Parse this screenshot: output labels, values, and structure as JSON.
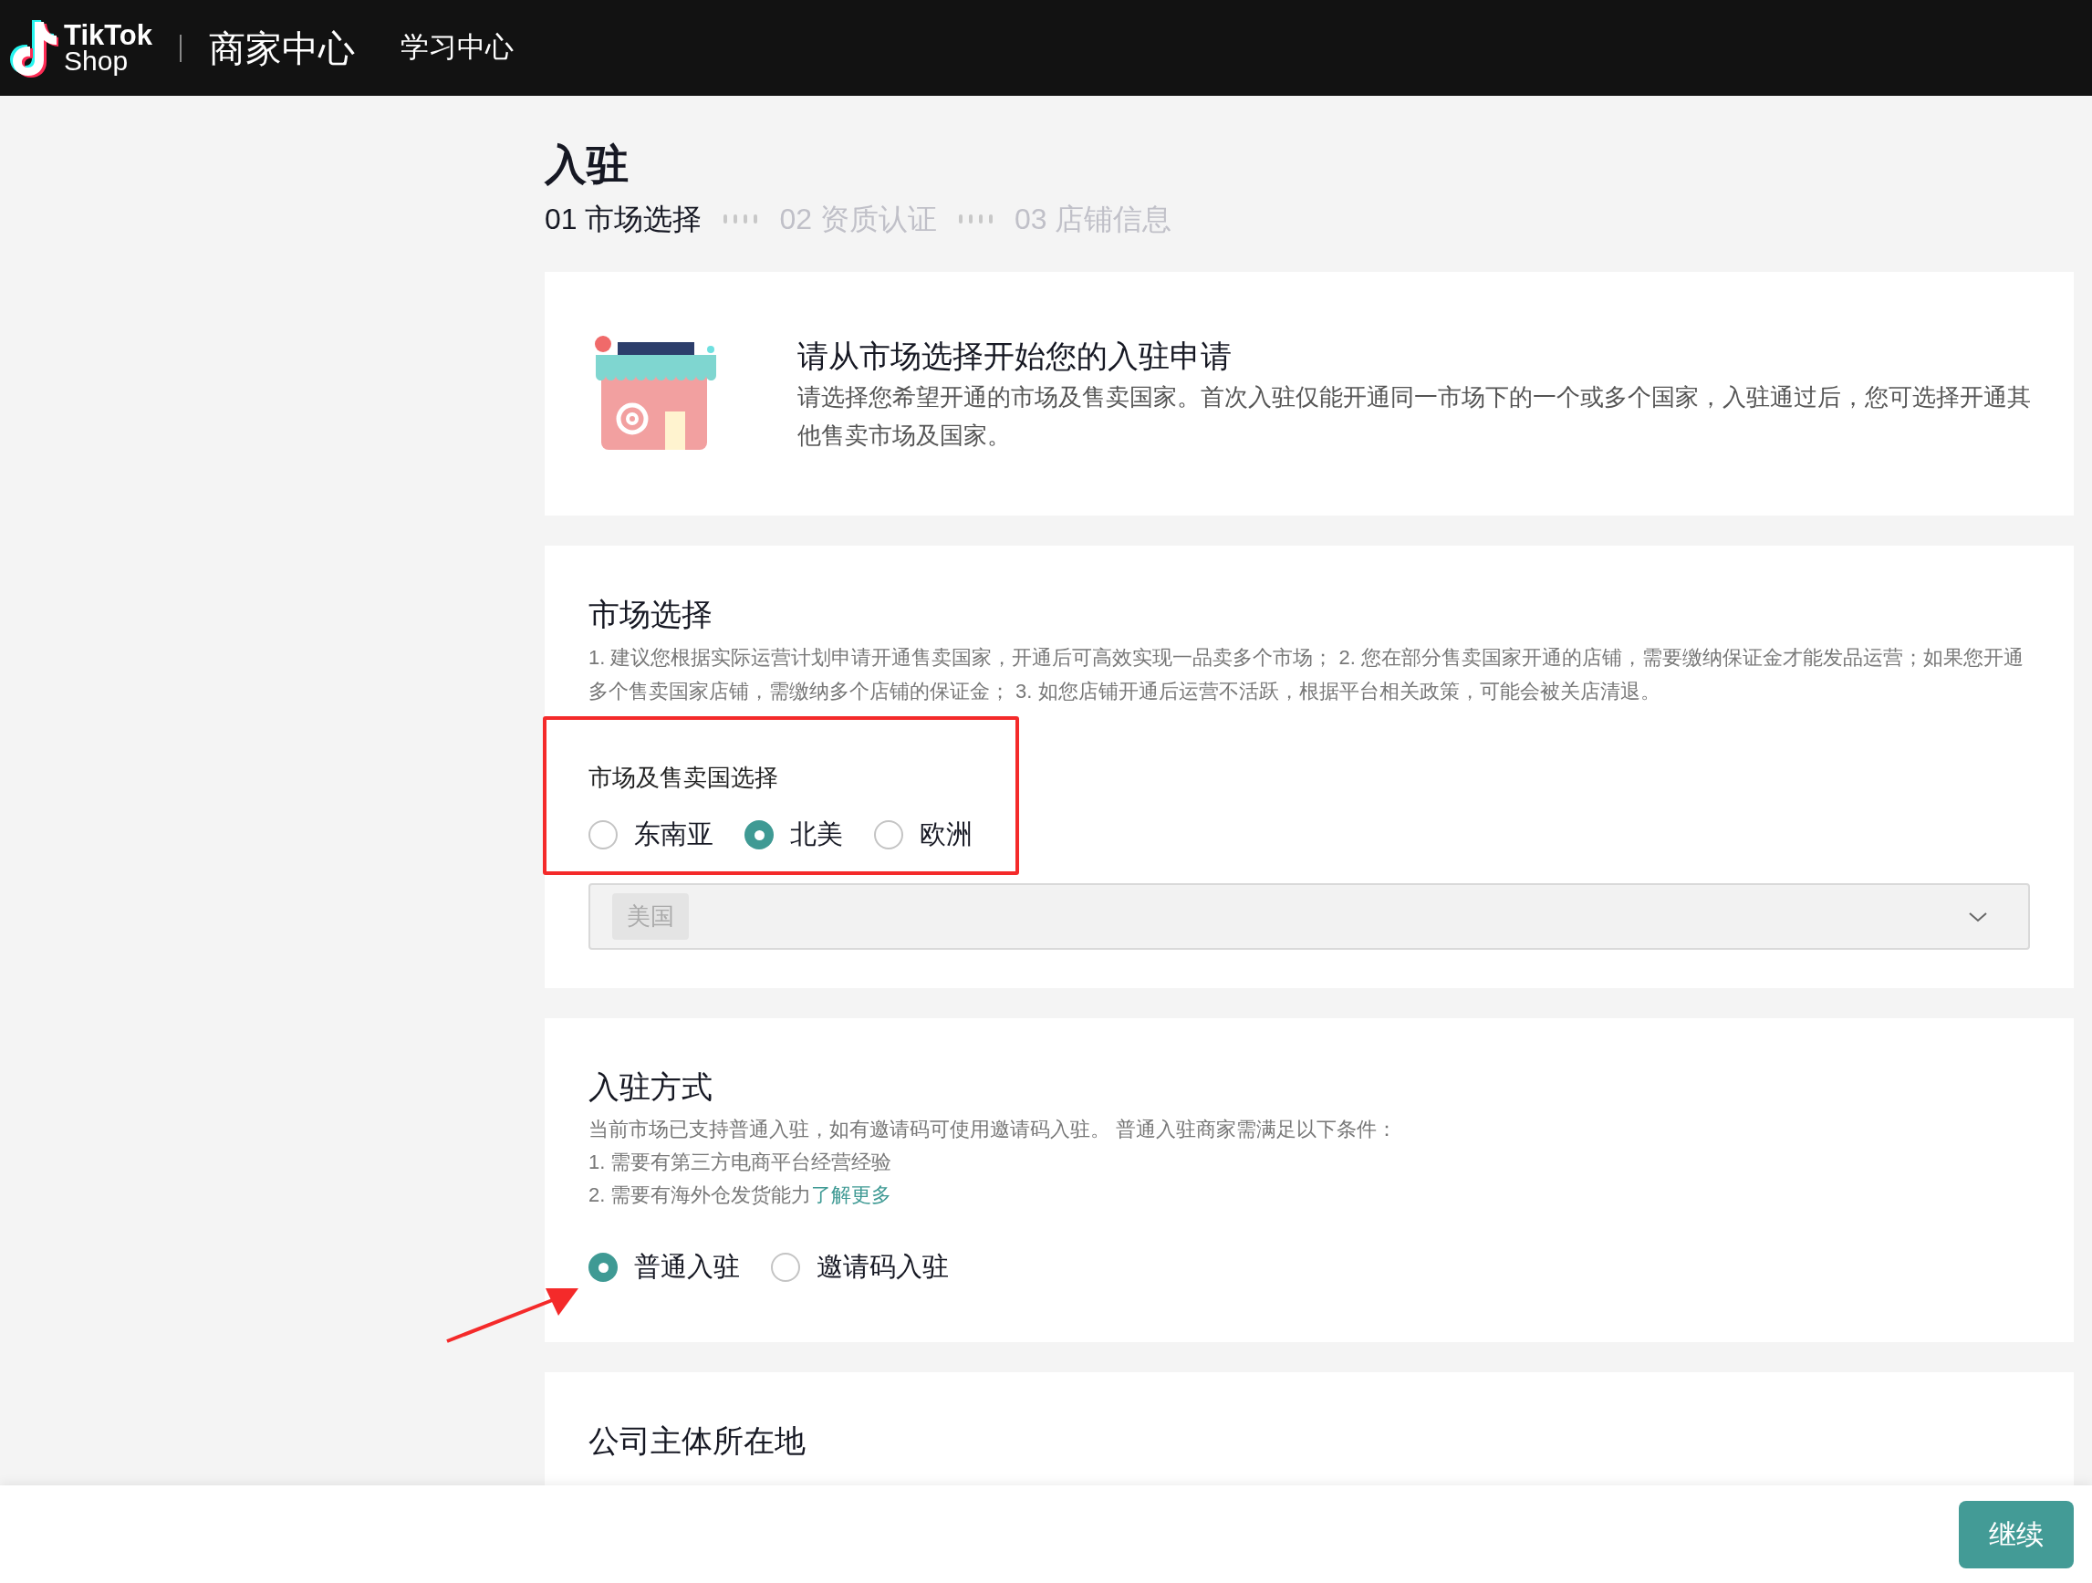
{
  "header": {
    "brand": [
      "TikTok",
      "Shop"
    ],
    "nav": [
      {
        "label": "商家中心",
        "selected": true
      },
      {
        "label": "学习中心",
        "selected": false
      }
    ]
  },
  "page_title": "入驻",
  "steps": [
    {
      "label": "01 市场选择",
      "active": true
    },
    {
      "label": "02 资质认证",
      "active": false
    },
    {
      "label": "03 店铺信息",
      "active": false
    }
  ],
  "intro": {
    "title": "请从市场选择开始您的入驻申请",
    "text": "请选择您希望开通的市场及售卖国家。首次入驻仅能开通同一市场下的一个或多个国家，入驻通过后，您可选择开通其他售卖市场及国家。"
  },
  "market": {
    "title": "市场选择",
    "note": "1. 建议您根据实际运营计划申请开通售卖国家，开通后可高效实现一品卖多个市场； 2. 您在部分售卖国家开通的店铺，需要缴纳保证金才能发品运营；如果您开通多个售卖国家店铺，需缴纳多个店铺的保证金； 3. 如您店铺开通后运营不活跃，根据平台相关政策，可能会被关店清退。",
    "group_label": "市场及售卖国选择",
    "options": [
      {
        "label": "东南亚",
        "selected": false
      },
      {
        "label": "北美",
        "selected": true
      },
      {
        "label": "欧洲",
        "selected": false
      }
    ],
    "countries": [
      "美国"
    ],
    "disabled": true
  },
  "entry": {
    "title": "入驻方式",
    "lines": [
      {
        "text": "当前市场已支持普通入驻，如有邀请码可使用邀请码入驻。 普通入驻商家需满足以下条件："
      },
      {
        "text": "1. 需要有第三方电商平台经营经验"
      },
      {
        "text": "2. 需要有海外仓发货能力",
        "link": "了解更多"
      }
    ],
    "options": [
      {
        "label": "普通入驻",
        "selected": true
      },
      {
        "label": "邀请码入驻",
        "selected": false
      }
    ]
  },
  "company": {
    "title": "公司主体所在地"
  },
  "continue_button": "继续"
}
